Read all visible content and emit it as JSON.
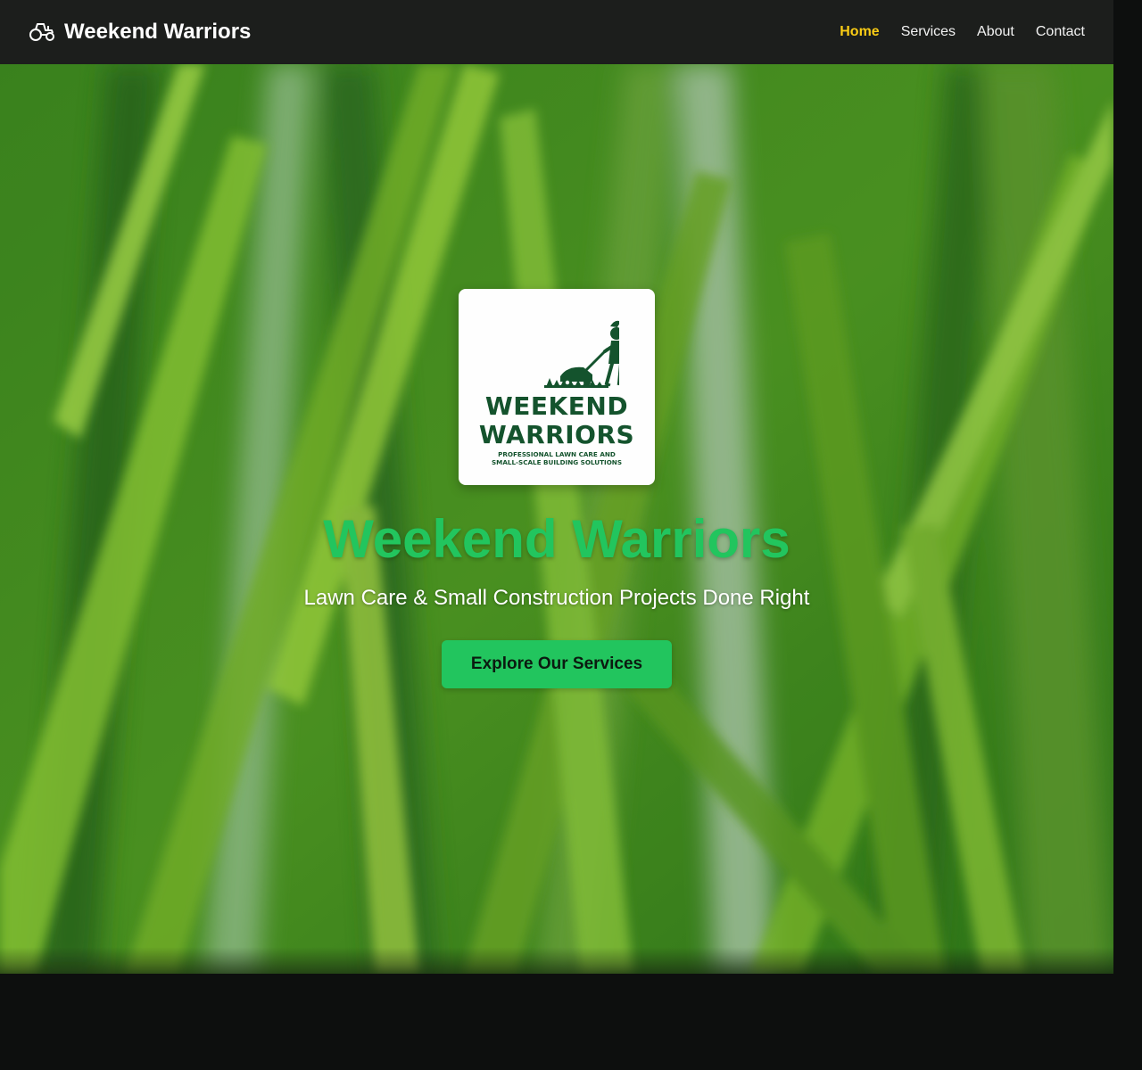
{
  "nav": {
    "brand": "Weekend Warriors",
    "brand_icon": "tractor-icon",
    "links": [
      {
        "label": "Home",
        "active": true
      },
      {
        "label": "Services",
        "active": false
      },
      {
        "label": "About",
        "active": false
      },
      {
        "label": "Contact",
        "active": false
      }
    ]
  },
  "hero": {
    "logo": {
      "figure_icon": "spartan-mowing-icon",
      "line1": "WEEKEND",
      "line2": "WARRIORS",
      "tagline_line1": "PROFESSIONAL LAWN CARE AND",
      "tagline_line2": "SMALL-SCALE BUILDING SOLUTIONS"
    },
    "title": "Weekend Warriors",
    "subtitle": "Lawn Care & Small Construction Projects Done Right",
    "cta_label": "Explore Our Services",
    "background": "blurred-grass-image"
  },
  "colors": {
    "accent": "#22c55e",
    "nav_active": "#facc15",
    "nav_bg": "#1c1e1c",
    "page_bg": "#0d0f0e",
    "logo_green": "#14532d"
  }
}
